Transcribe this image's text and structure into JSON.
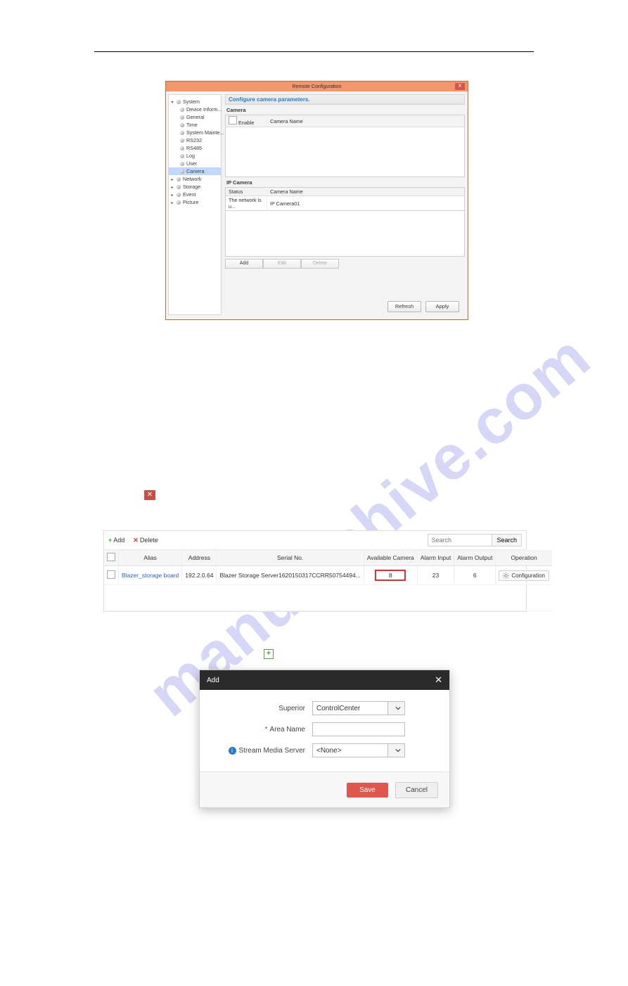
{
  "rc": {
    "title": "Remote Configuration",
    "tree": [
      {
        "label": "System",
        "root": true
      },
      {
        "label": "Device Inform..."
      },
      {
        "label": "General"
      },
      {
        "label": "Time"
      },
      {
        "label": "System Mainte..."
      },
      {
        "label": "RS232"
      },
      {
        "label": "RS485"
      },
      {
        "label": "Log"
      },
      {
        "label": "User"
      },
      {
        "label": "Camera",
        "selected": true
      },
      {
        "label": "Network",
        "root": true
      },
      {
        "label": "Storage",
        "root": true
      },
      {
        "label": "Event",
        "root": true
      },
      {
        "label": "Picture",
        "root": true
      }
    ],
    "header": "Configure camera parameters.",
    "cam_section": "Camera",
    "cam_cols": {
      "c1": "Enable",
      "c2": "Camera Name"
    },
    "ip_section": "IP Camera",
    "ip_cols": {
      "c1": "Status",
      "c2": "Camera Name"
    },
    "ip_row": {
      "c1": "The network is u...",
      "c2": "IP Camera01"
    },
    "btns": {
      "add": "Add",
      "edit": "Edit",
      "delete": "Delete",
      "refresh": "Refresh",
      "apply": "Apply"
    }
  },
  "dev": {
    "toolbar": {
      "add": "Add",
      "delete": "Delete"
    },
    "search": {
      "placeholder": "Search",
      "btn": "Search"
    },
    "cols": {
      "alias": "Alias",
      "addr": "Address",
      "serial": "Serial No.",
      "avail": "Available Camera",
      "ai": "Alarm Input",
      "ao": "Alarm Output",
      "op": "Operation"
    },
    "row": {
      "alias": "Blazer_storage board",
      "addr": "192.2.0.64",
      "serial": "Blazer Storage Server1620150317CCRR50754494...",
      "avail": "8",
      "ai": "23",
      "ao": "6",
      "op": "Configuration"
    }
  },
  "add": {
    "title": "Add",
    "labels": {
      "superior": "Superior",
      "area": "Area Name",
      "sms": "Stream Media Server"
    },
    "values": {
      "superior": "ControlCenter",
      "sms": "<None>"
    },
    "buttons": {
      "save": "Save",
      "cancel": "Cancel"
    }
  }
}
